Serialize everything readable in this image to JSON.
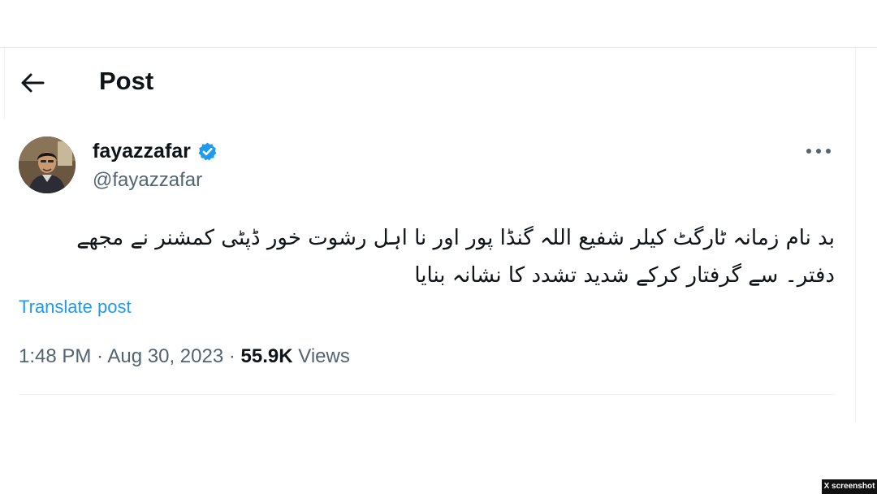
{
  "header": {
    "title": "Post",
    "back_icon": "arrow-left-icon"
  },
  "author": {
    "display_name": "fayazzafar",
    "handle": "@fayazzafar",
    "verified": true,
    "verified_color": "#1d9bf0"
  },
  "tweet": {
    "lines": [
      "بد نام زمانہ ٹارگٹ کیلر شفیع اللہ گنڈا پور اور نا اہل رشوت خور ڈپٹی کمشنر نے مجھے",
      "دفتر۔ سے گرفتار کرکے شدید تشدد کا نشانہ بنایا"
    ],
    "translate_label": "Translate post"
  },
  "meta": {
    "time": "1:48 PM",
    "separator": "·",
    "date": "Aug 30, 2023",
    "views_count": "55.9K",
    "views_label": "Views"
  },
  "watermark": "X screenshot",
  "colors": {
    "accent": "#1d9bf0",
    "text_primary": "#0f1419",
    "text_secondary": "#536471"
  }
}
